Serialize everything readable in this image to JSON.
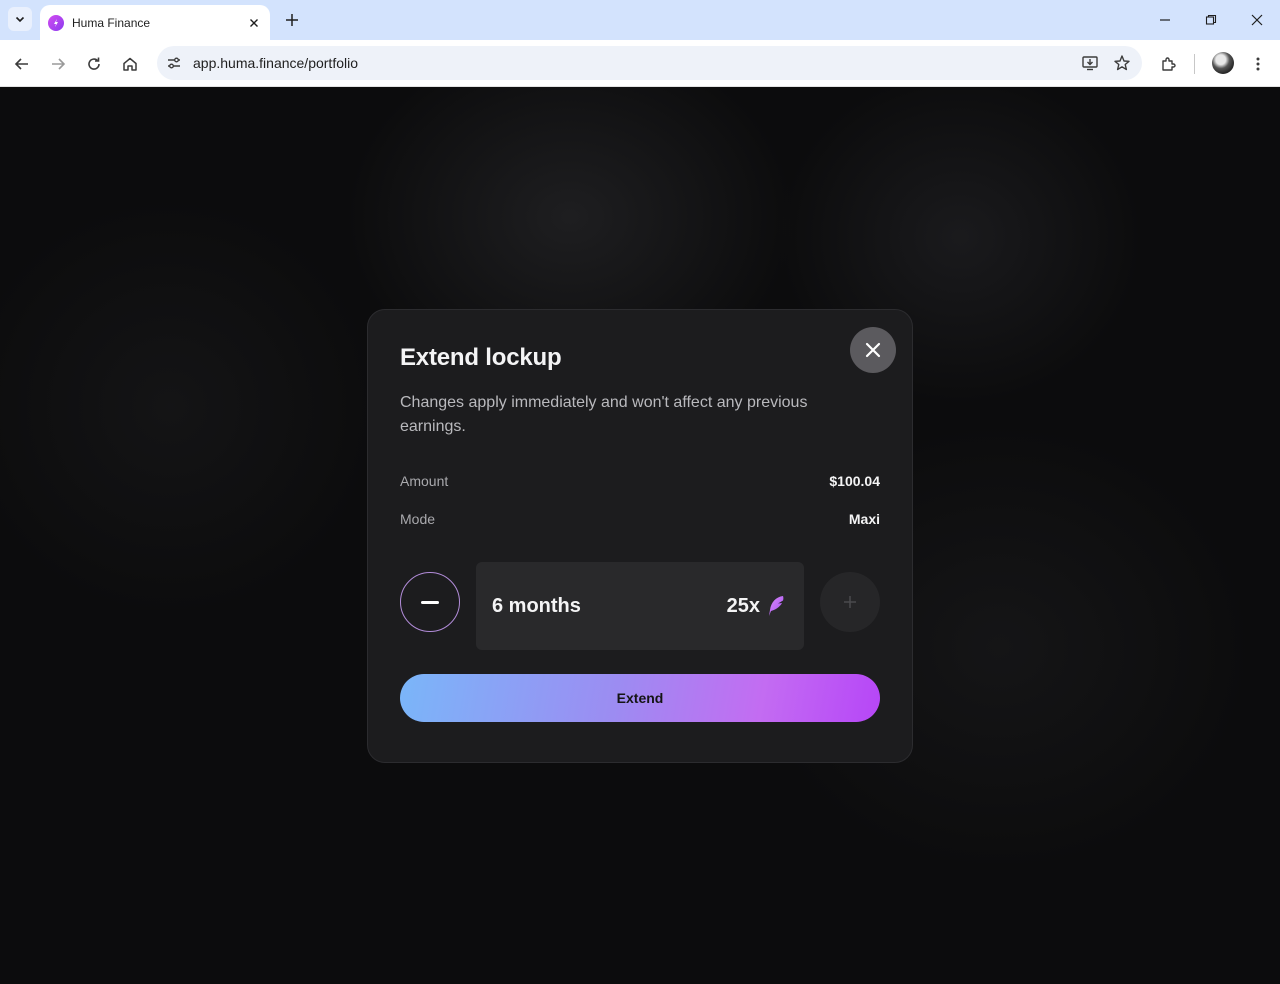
{
  "browser": {
    "tab_title": "Huma Finance",
    "url": "app.huma.finance/portfolio"
  },
  "modal": {
    "title": "Extend lockup",
    "description": "Changes apply immediately and won't affect any previous earnings.",
    "amount_label": "Amount",
    "amount_value": "$100.04",
    "mode_label": "Mode",
    "mode_value": "Maxi",
    "duration": "6 months",
    "multiplier": "25x",
    "extend_label": "Extend"
  },
  "colors": {
    "accent_purple": "#b646f7",
    "accent_blue": "#7ab6f9",
    "modal_bg": "#1c1c1e"
  }
}
